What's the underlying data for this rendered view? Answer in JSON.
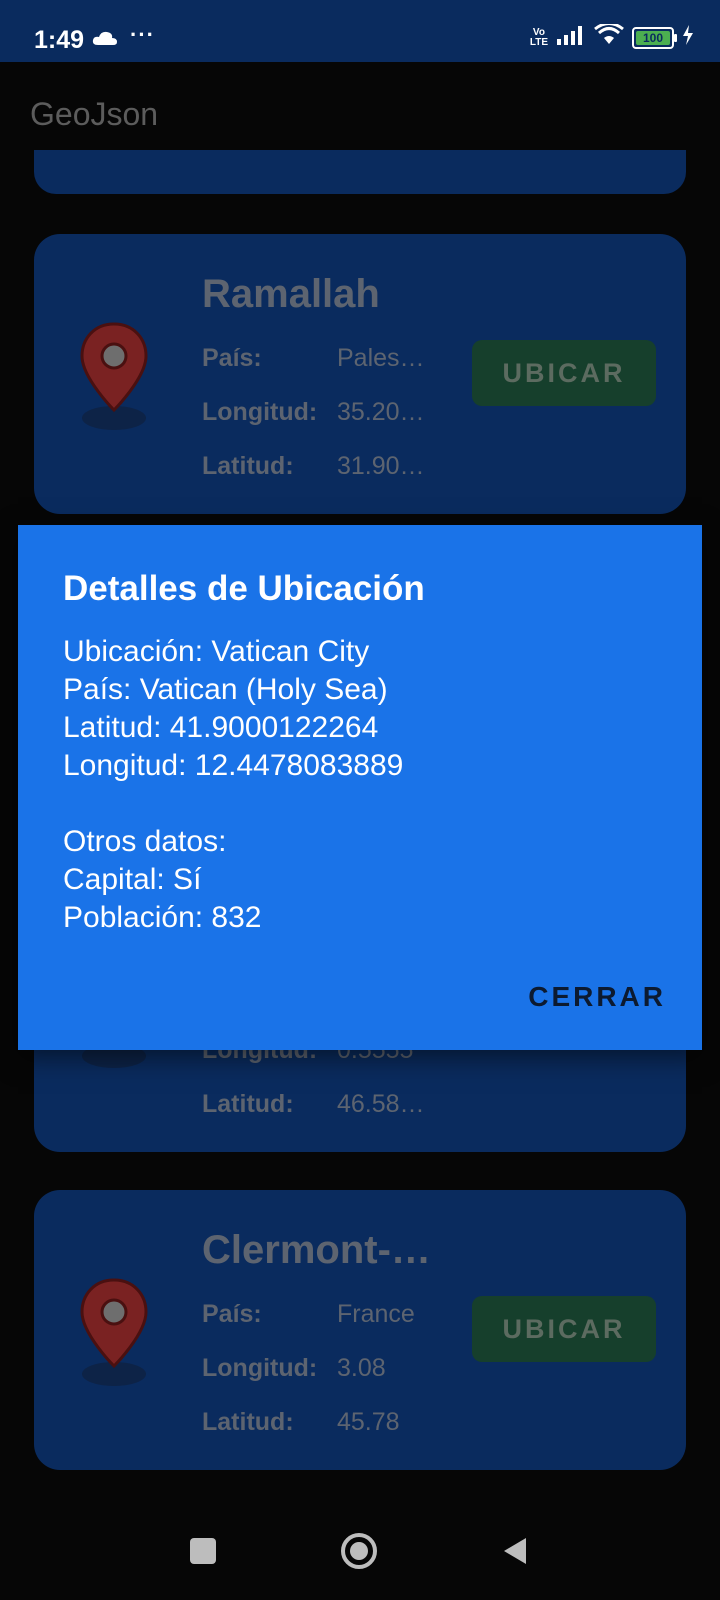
{
  "status_bar": {
    "time": "1:49",
    "dots": "···",
    "network": "Vo\nLTE",
    "battery": "100"
  },
  "app": {
    "title": "GeoJson"
  },
  "labels": {
    "country": "País:",
    "longitude": "Longitud:",
    "latitude": "Latitud:",
    "locate_button": "UBICAR"
  },
  "cards": [
    {
      "name": "Ramallah",
      "country": "Pales…",
      "longitude": "35.20…",
      "latitude": "31.90…"
    },
    {
      "name": "",
      "country": "",
      "longitude": "0.5555",
      "latitude": "46.58…"
    },
    {
      "name": "Clermont-…",
      "country": "France",
      "longitude": "3.08",
      "latitude": "45.78"
    }
  ],
  "dialog": {
    "title": "Detalles de Ubicación",
    "lines": [
      "Ubicación: Vatican City",
      "País: Vatican (Holy Sea)",
      "Latitud: 41.9000122264",
      "Longitud: 12.4478083889"
    ],
    "extra_lines": [
      "Otros datos:",
      "Capital: Sí",
      "Población: 832"
    ],
    "close_label": "CERRAR"
  },
  "icons": {
    "pin": "location-pin-icon",
    "cloud": "cloud-icon",
    "signal": "signal-icon",
    "wifi": "wifi-icon",
    "battery": "battery-icon",
    "charging": "charging-icon"
  },
  "colors": {
    "status_bar": "#0a2b5e",
    "card": "#0a2b5e",
    "dialog": "#1a73e8",
    "locate_button": "#163f2c",
    "pin": "#7a2222"
  }
}
